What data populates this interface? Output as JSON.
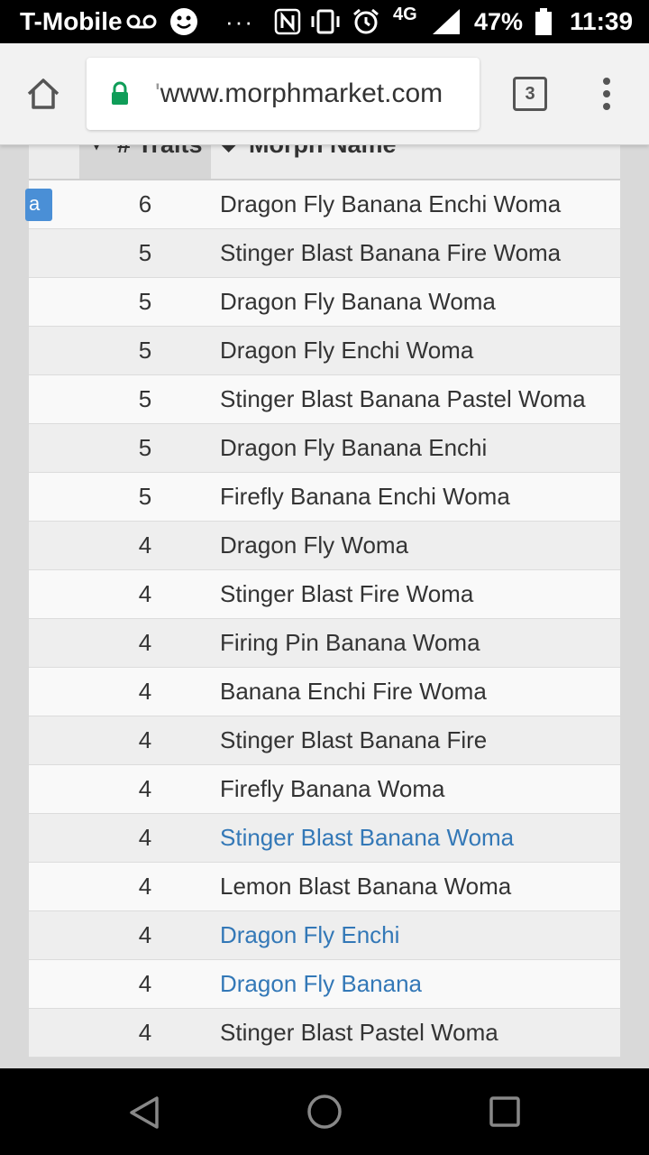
{
  "status_bar": {
    "carrier": "T-Mobile",
    "network": "4G",
    "battery": "47%",
    "time": "11:39",
    "more": "···"
  },
  "browser": {
    "url": "www.morphmarket.com",
    "url_prefix": "'",
    "tab_count": "3",
    "icons": {
      "home": "home-icon",
      "lock": "lock-icon",
      "tabs": "tabs-icon",
      "menu": "menu-icon"
    },
    "accent_lock": "#0f9d58"
  },
  "table": {
    "header": {
      "traits": "# Traits",
      "name": "Morph Name"
    },
    "first_row_tag": "a",
    "rows": [
      {
        "traits": "6",
        "name": "Dragon Fly Banana Enchi Woma",
        "link": false
      },
      {
        "traits": "5",
        "name": "Stinger Blast Banana Fire Woma",
        "link": false
      },
      {
        "traits": "5",
        "name": "Dragon Fly Banana Woma",
        "link": false
      },
      {
        "traits": "5",
        "name": "Dragon Fly Enchi Woma",
        "link": false
      },
      {
        "traits": "5",
        "name": "Stinger Blast Banana Pastel Woma",
        "link": false
      },
      {
        "traits": "5",
        "name": "Dragon Fly Banana Enchi",
        "link": false
      },
      {
        "traits": "5",
        "name": "Firefly Banana Enchi Woma",
        "link": false
      },
      {
        "traits": "4",
        "name": "Dragon Fly Woma",
        "link": false
      },
      {
        "traits": "4",
        "name": "Stinger Blast Fire Woma",
        "link": false
      },
      {
        "traits": "4",
        "name": "Firing Pin Banana Woma",
        "link": false
      },
      {
        "traits": "4",
        "name": "Banana Enchi Fire Woma",
        "link": false
      },
      {
        "traits": "4",
        "name": "Stinger Blast Banana Fire",
        "link": false
      },
      {
        "traits": "4",
        "name": "Firefly Banana Woma",
        "link": false
      },
      {
        "traits": "4",
        "name": "Stinger Blast Banana Woma",
        "link": true
      },
      {
        "traits": "4",
        "name": "Lemon Blast Banana Woma",
        "link": false
      },
      {
        "traits": "4",
        "name": "Dragon Fly Enchi",
        "link": true
      },
      {
        "traits": "4",
        "name": "Dragon Fly Banana",
        "link": true
      },
      {
        "traits": "4",
        "name": "Stinger Blast Pastel Woma",
        "link": false
      }
    ],
    "colors": {
      "link": "#3378b7",
      "tag": "#4a8fd6"
    }
  },
  "nav_bar": {
    "back": "back-icon",
    "home": "home-circle-icon",
    "recents": "recents-icon"
  }
}
